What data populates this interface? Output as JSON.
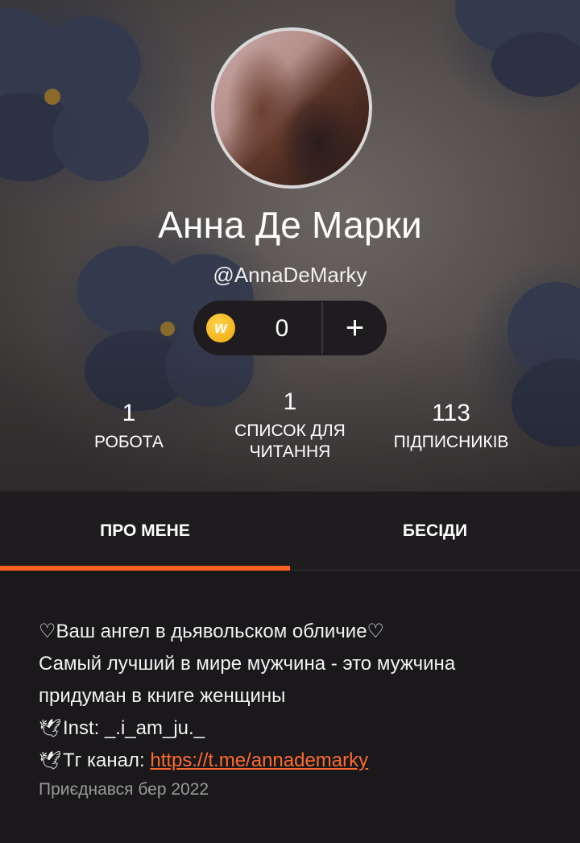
{
  "profile": {
    "name": "Анна Де Марки",
    "handle": "@AnnaDeMarky",
    "coins": "0",
    "coin_symbol": "w",
    "add_coins_symbol": "+"
  },
  "stats": [
    {
      "value": "1",
      "label": "РОБОТА"
    },
    {
      "value": "1",
      "label": "СПИСОК ДЛЯ ЧИТАННЯ"
    },
    {
      "value": "113",
      "label": "ПІДПИСНИКІВ"
    }
  ],
  "tabs": {
    "about": "ПРО МЕНЕ",
    "conversations": "БЕСІДИ"
  },
  "about": {
    "line1": "♡Ваш ангел в дьявольском обличие♡",
    "line2": "Самый лучший в мире мужчина - это мужчина придуман в книге женщины",
    "inst_label": "Inst: _.i_am_ju._",
    "tg_label": "Тг канал: ",
    "tg_link": "https://t.me/annademarky",
    "joined": "Приєднався бер 2022"
  },
  "colors": {
    "accent": "#ff6122",
    "link": "#ff6a2c",
    "coin": "#f2a60c",
    "background": "#1a181b"
  },
  "icons": {
    "coin": "wattpad-coin-icon",
    "plus": "plus-icon",
    "dove": "dove-icon"
  }
}
